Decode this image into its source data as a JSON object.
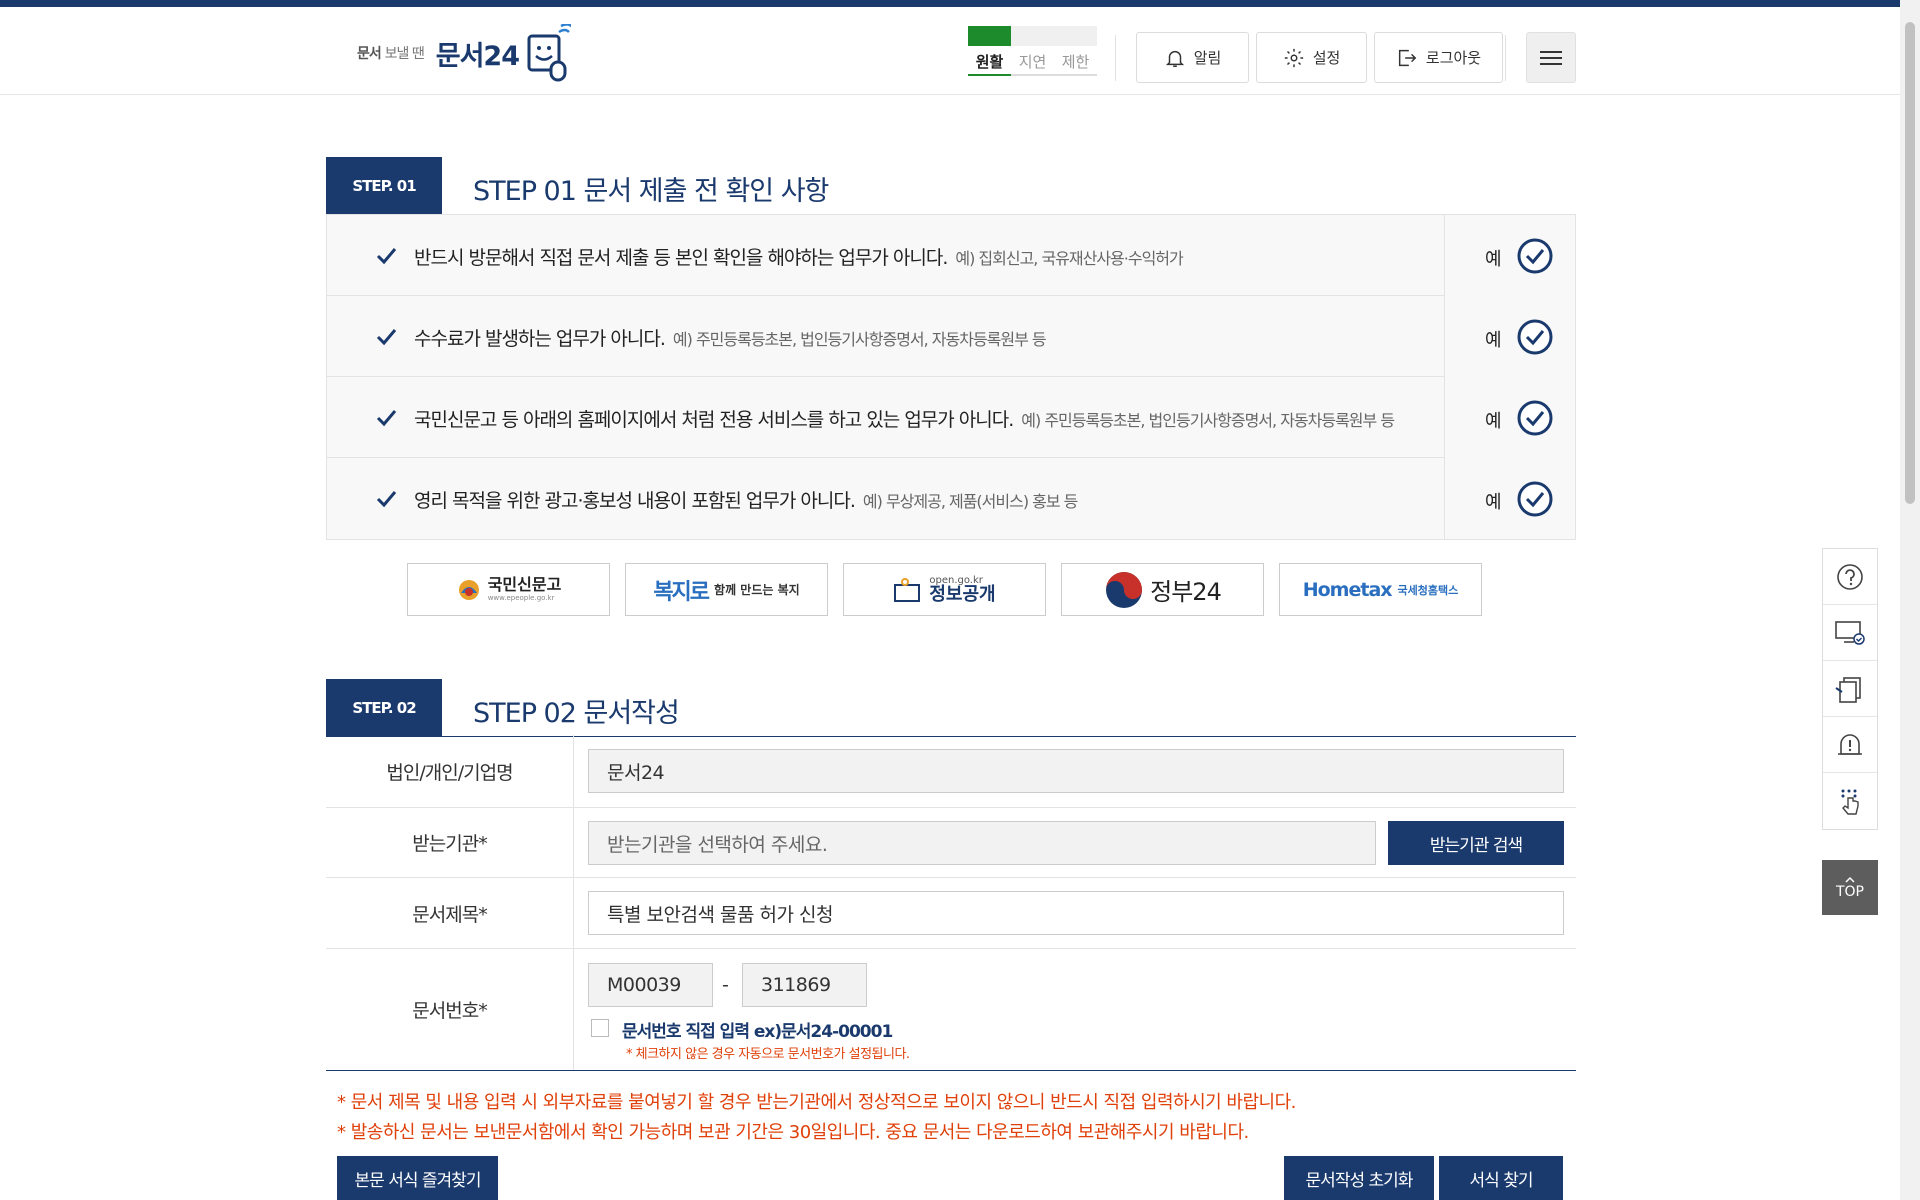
{
  "header": {
    "logo_tagline_bold": "문서",
    "logo_tagline_rest": "보낼 땐",
    "logo_name": "문서24",
    "traffic": [
      {
        "label": "원활",
        "active": true
      },
      {
        "label": "지연",
        "active": false
      },
      {
        "label": "제한",
        "active": false
      }
    ],
    "buttons": {
      "alarm": "알림",
      "settings": "설정",
      "logout": "로그아웃"
    }
  },
  "step1": {
    "tag": "STEP. 01",
    "title": "STEP 01 문서 제출 전 확인 사항",
    "items": [
      {
        "text": "반드시 방문해서 직접 문서 제출 등 본인 확인을 해야하는 업무가 아니다.",
        "example": "예) 집회신고, 국유재산사용·수익허가",
        "answer": "예"
      },
      {
        "text": "수수료가 발생하는 업무가 아니다.",
        "example": "예) 주민등록등초본, 법인등기사항증명서, 자동차등록원부 등",
        "answer": "예"
      },
      {
        "text": "국민신문고 등 아래의 홈페이지에서 처럼 전용 서비스를 하고 있는 업무가 아니다.",
        "example": "예) 주민등록등초본, 법인등기사항증명서, 자동차등록원부 등",
        "answer": "예"
      },
      {
        "text": "영리 목적을 위한 광고·홍보성 내용이 포함된 업무가 아니다.",
        "example": "예) 무상제공, 제품(서비스) 홍보 등",
        "answer": "예"
      }
    ]
  },
  "banners": {
    "epeople": {
      "name": "국민신문고",
      "url": "www.epeople.go.kr"
    },
    "bokjiro": {
      "name": "복지로",
      "tagline": "함께 만드는 복지"
    },
    "opengov": {
      "url": "open.go.kr",
      "name": "정보공개"
    },
    "gov24": {
      "name": "정부24"
    },
    "hometax": {
      "name": "Hometax",
      "tagline": "국세청홈택스"
    }
  },
  "step2": {
    "tag": "STEP. 02",
    "title": "STEP 02 문서작성",
    "fields": {
      "org_label": "법인/개인/기업명",
      "org_value": "문서24",
      "receiver_label": "받는기관*",
      "receiver_placeholder": "받는기관을 선택하여 주세요.",
      "receiver_search_btn": "받는기관 검색",
      "subject_label": "문서제목*",
      "subject_value": "특별 보안검색 물품 허가 신청",
      "docnum_label": "문서번호*",
      "docnum_prefix": "M00039",
      "docnum_sep": "-",
      "docnum_suffix": "311869",
      "direct_input_label": "문서번호 직접 입력 ex)문서24-00001",
      "direct_input_note": "* 체크하지 않은 경우 자동으로 문서번호가 설정됩니다."
    }
  },
  "notices": [
    "* 문서 제목 및 내용 입력 시 외부자료를 붙여넣기 할 경우 받는기관에서 정상적으로 보이지 않으니 반드시 직접 입력하시기 바랍니다.",
    "* 발송하신 문서는 보낸문서함에서 확인 가능하며 보관 기간은 30일입니다. 중요 문서는 다운로드하여 보관해주시기 바랍니다."
  ],
  "bottom_buttons": {
    "favorite_form": "본문 서식 즐겨찾기",
    "reset": "문서작성 초기화",
    "find_form": "서식 찾기"
  },
  "side": {
    "top_label": "TOP"
  },
  "colors": {
    "navy": "#1a3a6e",
    "green": "#1d8a2c",
    "notice": "#e0400a"
  }
}
